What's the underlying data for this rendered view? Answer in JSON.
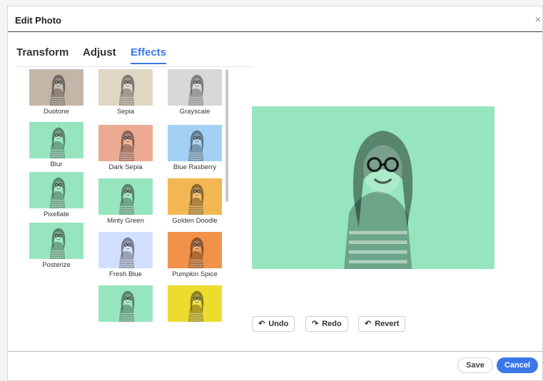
{
  "dialog": {
    "title": "Edit Photo",
    "close_glyph": "×"
  },
  "tabs": [
    {
      "label": "Transform",
      "active": false
    },
    {
      "label": "Adjust",
      "active": false
    },
    {
      "label": "Effects",
      "active": true
    }
  ],
  "effects": [
    {
      "label": "Duotone",
      "color": "#b6a797"
    },
    {
      "label": "Blur",
      "color": "#7fe0b0"
    },
    {
      "label": "Pixellate",
      "color": "#7fe0b0"
    },
    {
      "label": "Posterize",
      "color": "#7fe0b0"
    },
    {
      "label": "Sepia",
      "color": "#d9cdb8"
    },
    {
      "label": "Dark Sepia",
      "color": "#e8987a"
    },
    {
      "label": "Minty Green",
      "color": "#7fe0b0"
    },
    {
      "label": "Fresh Blue",
      "color": "#c9d8ff"
    },
    {
      "label": "",
      "color": "#7fe0b0"
    },
    {
      "label": "Grayscale",
      "color": "#d0d0d0"
    },
    {
      "label": "Blue Rasberry",
      "color": "#8fc7f2"
    },
    {
      "label": "Golden Doodle",
      "color": "#f0a72c"
    },
    {
      "label": "Pumpkin Spice",
      "color": "#ef7a23"
    },
    {
      "label": "",
      "color": "#e9d400"
    }
  ],
  "preview": {
    "color": "#7fe0b0"
  },
  "history": {
    "undo": {
      "icon": "undo-icon",
      "glyph": "↶",
      "label": "Undo"
    },
    "redo": {
      "icon": "redo-icon",
      "glyph": "↷",
      "label": "Redo"
    },
    "revert": {
      "icon": "revert-icon",
      "glyph": "↶",
      "label": "Revert"
    }
  },
  "footer": {
    "save_label": "Save",
    "cancel_label": "Cancel",
    "accent": "#3b78e7"
  }
}
